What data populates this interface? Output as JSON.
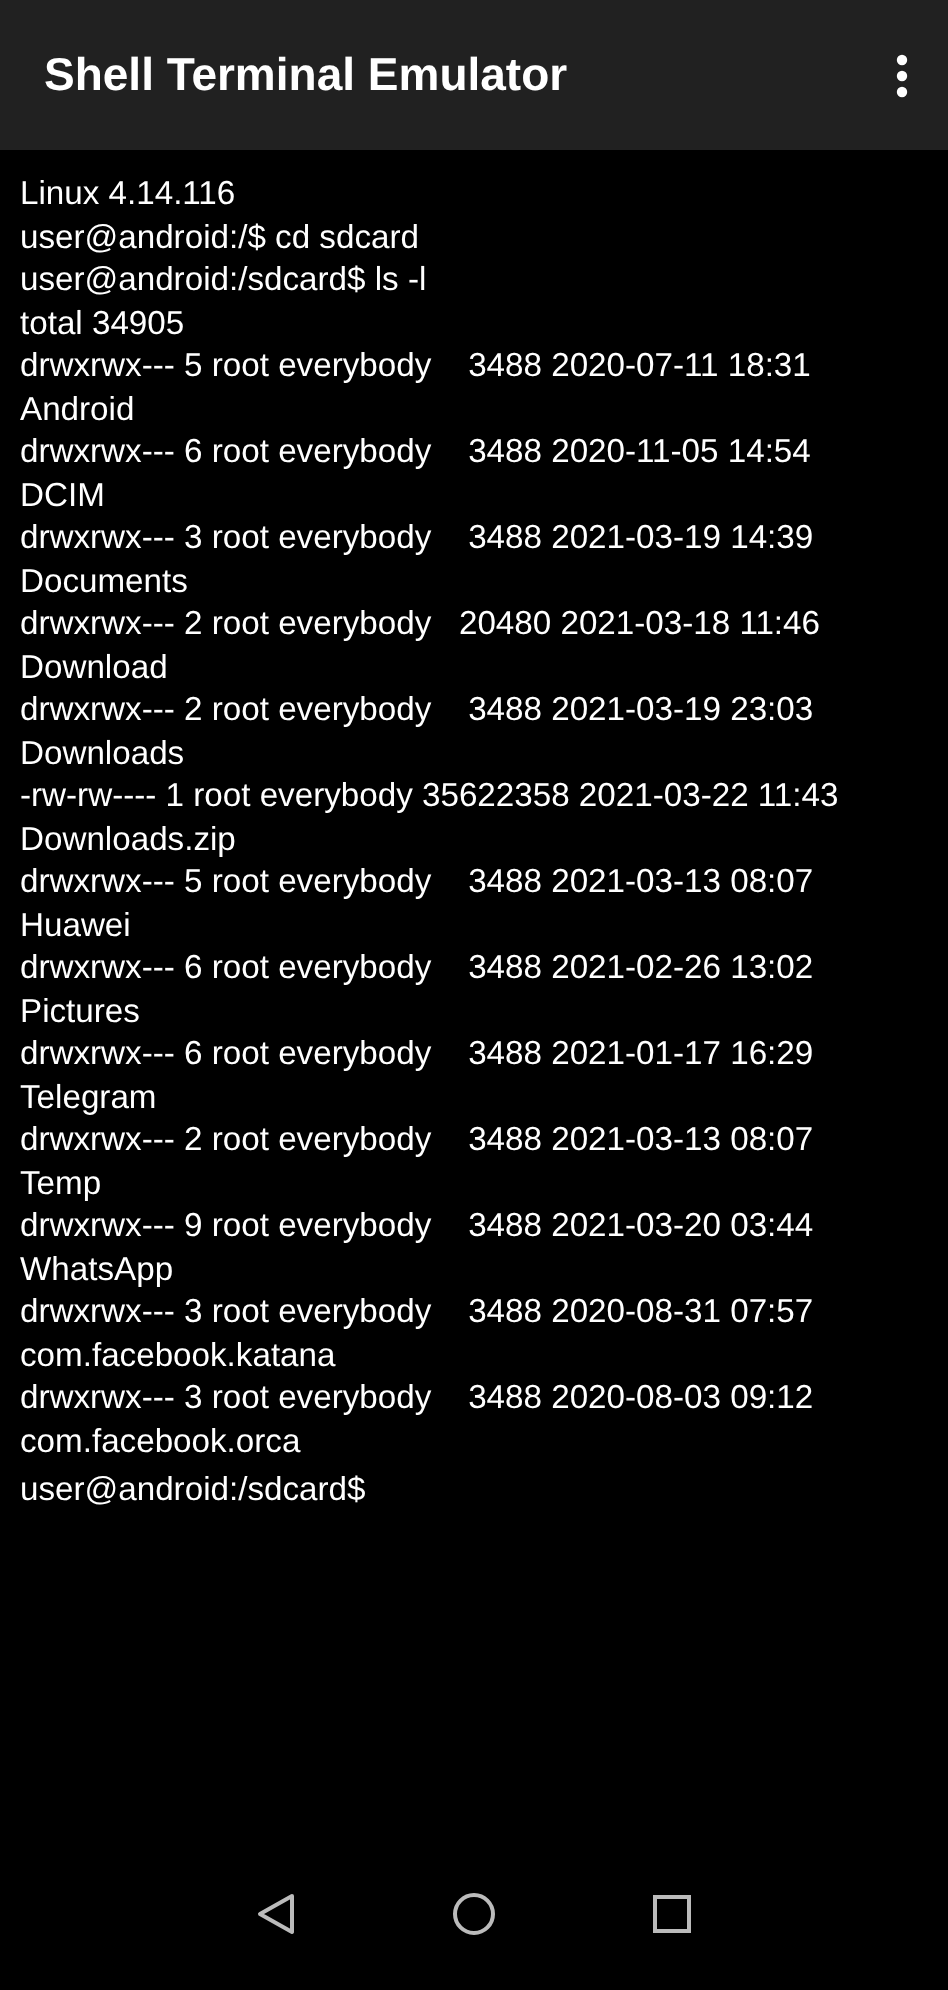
{
  "app_bar": {
    "title": "Shell Terminal Emulator"
  },
  "terminal": {
    "lines": [
      "Linux 4.14.116",
      "user@android:/$ cd sdcard",
      "user@android:/sdcard$ ls -l",
      "total 34905",
      "drwxrwx--- 5 root everybody    3488 2020-07-11 18:31",
      "Android",
      "drwxrwx--- 6 root everybody    3488 2020-11-05 14:54",
      "DCIM",
      "drwxrwx--- 3 root everybody    3488 2021-03-19 14:39",
      "Documents",
      "drwxrwx--- 2 root everybody   20480 2021-03-18 11:46",
      "Download",
      "drwxrwx--- 2 root everybody    3488 2021-03-19 23:03",
      "Downloads",
      "-rw-rw---- 1 root everybody 35622358 2021-03-22 11:43",
      "Downloads.zip",
      "drwxrwx--- 5 root everybody    3488 2021-03-13 08:07",
      "Huawei",
      "drwxrwx--- 6 root everybody    3488 2021-02-26 13:02",
      "Pictures",
      "drwxrwx--- 6 root everybody    3488 2021-01-17 16:29",
      "Telegram",
      "drwxrwx--- 2 root everybody    3488 2021-03-13 08:07",
      "Temp",
      "drwxrwx--- 9 root everybody    3488 2021-03-20 03:44",
      "WhatsApp",
      "drwxrwx--- 3 root everybody    3488 2020-08-31 07:57",
      "com.facebook.katana",
      "drwxrwx--- 3 root everybody    3488 2020-08-03 09:12",
      "com.facebook.orca"
    ],
    "prompt": "user@android:/sdcard$"
  }
}
